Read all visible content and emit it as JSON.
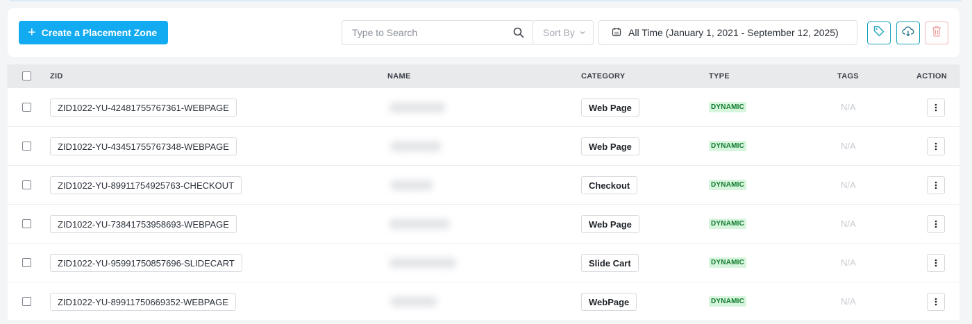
{
  "toolbar": {
    "create_label": "Create a Placement Zone",
    "search_placeholder": "Type to Search",
    "sort_label": "Sort By",
    "date_range": "All Time (January 1, 2021 - September 12, 2025)"
  },
  "colors": {
    "primary": "#12aaf0",
    "teal": "#1aa3b8",
    "danger": "#e26b6b",
    "dynamic_bg": "#d6f5dc",
    "dynamic_text": "#0f7a2d"
  },
  "table": {
    "headers": {
      "zid": "ZID",
      "name": "NAME",
      "category": "CATEGORY",
      "type": "TYPE",
      "tags": "TAGS",
      "action": "ACTION"
    },
    "rows": [
      {
        "zid": "ZID1022-YU-42481755767361-WEBPAGE",
        "category": "Web Page",
        "type": "DYNAMIC",
        "tags": "N/A"
      },
      {
        "zid": "ZID1022-YU-43451755767348-WEBPAGE",
        "category": "Web Page",
        "type": "DYNAMIC",
        "tags": "N/A"
      },
      {
        "zid": "ZID1022-YU-89911754925763-CHECKOUT",
        "category": "Checkout",
        "type": "DYNAMIC",
        "tags": "N/A"
      },
      {
        "zid": "ZID1022-YU-73841753958693-WEBPAGE",
        "category": "Web Page",
        "type": "DYNAMIC",
        "tags": "N/A"
      },
      {
        "zid": "ZID1022-YU-95991750857696-SLIDECART",
        "category": "Slide Cart",
        "type": "DYNAMIC",
        "tags": "N/A"
      },
      {
        "zid": "ZID1022-YU-89911750669352-WEBPAGE",
        "category": "WebPage",
        "type": "DYNAMIC",
        "tags": "N/A"
      }
    ]
  }
}
